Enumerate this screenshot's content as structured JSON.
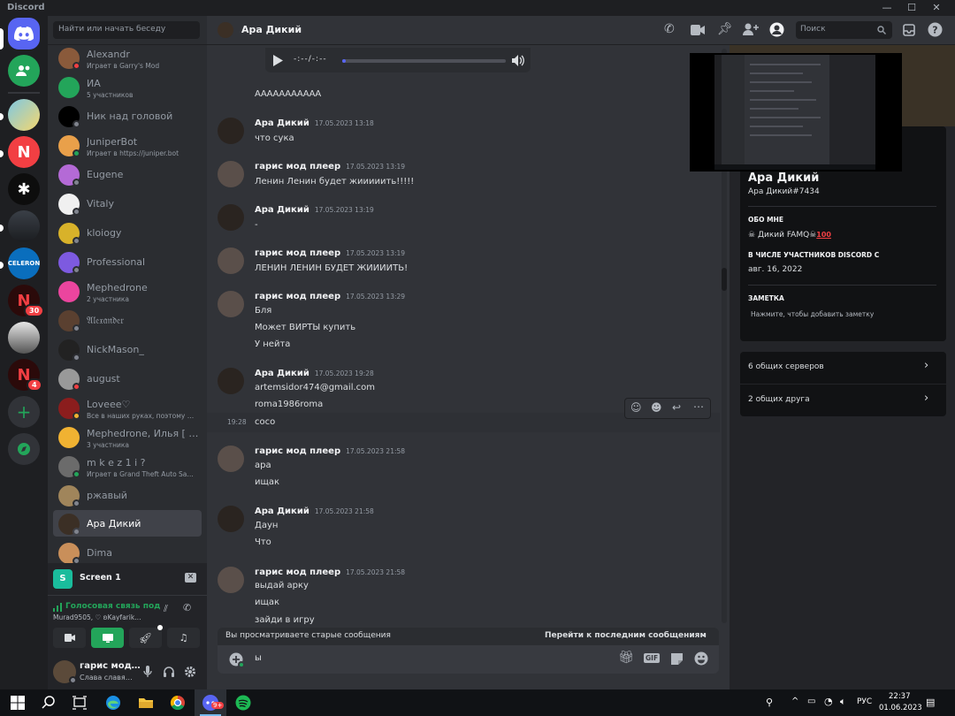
{
  "window": {
    "app_title": "Discord",
    "minimize": "—",
    "maximize": "☐",
    "close": "✕"
  },
  "colors": {
    "accent": "#5865f2",
    "online": "#23a55a",
    "dnd": "#f23f43",
    "idle": "#f0b232",
    "bg": "#313338"
  },
  "guilds": {
    "badges": [
      "30",
      "4"
    ]
  },
  "sidebar": {
    "search_placeholder": "Найти или начать беседу",
    "dms": [
      {
        "name": "Alexandr",
        "sub": "Играет в Garry's Mod"
      },
      {
        "name": "ИА",
        "sub": "5 участников"
      },
      {
        "name": "Ник над головой",
        "sub": ""
      },
      {
        "name": "JuniperBot",
        "sub": "Играет в https://juniper.bot"
      },
      {
        "name": "Eugene",
        "sub": ""
      },
      {
        "name": "Vitaly",
        "sub": ""
      },
      {
        "name": "kloiogy",
        "sub": ""
      },
      {
        "name": "Professional",
        "sub": ""
      },
      {
        "name": "Mephedrone",
        "sub": "2 участника"
      },
      {
        "name": "𝔄𝔩𝔢𝔵𝔞𝔫𝔡𝔢𝔯",
        "sub": ""
      },
      {
        "name": "NickMason_",
        "sub": ""
      },
      {
        "name": "august",
        "sub": ""
      },
      {
        "name": "Loveee♡",
        "sub": "Все в наших руках, поэтому …"
      },
      {
        "name": "Mephedrone, Илья [ …",
        "sub": "3 участника"
      },
      {
        "name": "m k e z 1 i ?",
        "sub": "Играет в Grand Theft Auto Sa…"
      },
      {
        "name": "ржавый",
        "sub": ""
      },
      {
        "name": "Ара Дикий",
        "sub": ""
      },
      {
        "name": "Dima",
        "sub": ""
      }
    ]
  },
  "screen_share": {
    "label": "Screen 1",
    "voice_status": "Голосовая связь под",
    "voice_users": "Murad9505, ♡ ʚKayfarik…"
  },
  "user": {
    "name": "гарис мод…",
    "status": "Слава славя…"
  },
  "header": {
    "title": "Ара Дикий",
    "search_placeholder": "Поиск"
  },
  "audio": {
    "time": "-:--/-:--"
  },
  "messages": {
    "top_line": "ААААААААААА",
    "groups": [
      {
        "author": "Ара Дикий",
        "time": "17.05.2023 13:18",
        "lines": [
          "что сука"
        ]
      },
      {
        "author": "гарис мод плеер",
        "time": "17.05.2023 13:19",
        "lines": [
          "Ленин Ленин будет жииииить!!!!!"
        ]
      },
      {
        "author": "Ара Дикий",
        "time": "17.05.2023 13:19",
        "lines": [
          "-"
        ]
      },
      {
        "author": "гарис мод плеер",
        "time": "17.05.2023 13:19",
        "lines": [
          "ЛЕНИН ЛЕНИН БУДЕТ ЖИИИИТЬ!"
        ]
      },
      {
        "author": "гарис мод плеер",
        "time": "17.05.2023 13:29",
        "lines": [
          "Бля",
          "Может ВИРТЫ купить",
          "У нейта"
        ]
      },
      {
        "author": "Ара Дикий",
        "time": "17.05.2023 19:28",
        "lines": [
          "artemsidor474@gmail.com",
          "roma1986roma",
          "coco"
        ]
      },
      {
        "author": "гарис мод плеер",
        "time": "17.05.2023 21:58",
        "lines": [
          "ара",
          "ищак"
        ]
      },
      {
        "author": "Ара Дикий",
        "time": "17.05.2023 21:58",
        "lines": [
          "Даун",
          "Что"
        ]
      },
      {
        "author": "гарис мод плеер",
        "time": "17.05.2023 21:58",
        "lines": [
          "выдай арку",
          "ищак",
          "зайди в игру"
        ]
      }
    ],
    "hover_time": "19:28"
  },
  "old_messages_bar": {
    "left": "Вы просматриваете старые сообщения",
    "right": "Перейти к последним сообщениям"
  },
  "composer": {
    "text": "ы",
    "gif": "GIF"
  },
  "profile": {
    "name": "Ара Дикий",
    "tag": "Ара Дикий#7434",
    "about_title": "ОБО МНЕ",
    "about": "Дикий FAMQ",
    "member_since_title": "В ЧИСЛЕ УЧАСТНИКОВ DISCORD С",
    "member_since": "авг. 16, 2022",
    "note_title": "ЗАМЕТКА",
    "note_placeholder": "Нажмите, чтобы добавить заметку",
    "mutual_servers": "6 общих серверов",
    "mutual_friends": "2 общих друга"
  },
  "taskbar": {
    "lang": "РУС",
    "time": "22:37",
    "date": "01.06.2023",
    "discord_badge": "9+"
  }
}
